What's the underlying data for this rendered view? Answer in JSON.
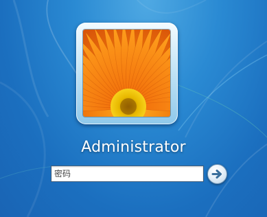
{
  "login": {
    "username": "Administrator",
    "password_field": {
      "value": "",
      "placeholder": "密码"
    },
    "submit_icon": "arrow-right-icon",
    "avatar": "orange-flower-picture"
  },
  "colors": {
    "background": "#1b6fbf",
    "flower_petal": "#f07a10",
    "flower_center": "#e6b400",
    "text": "#ffffff"
  }
}
